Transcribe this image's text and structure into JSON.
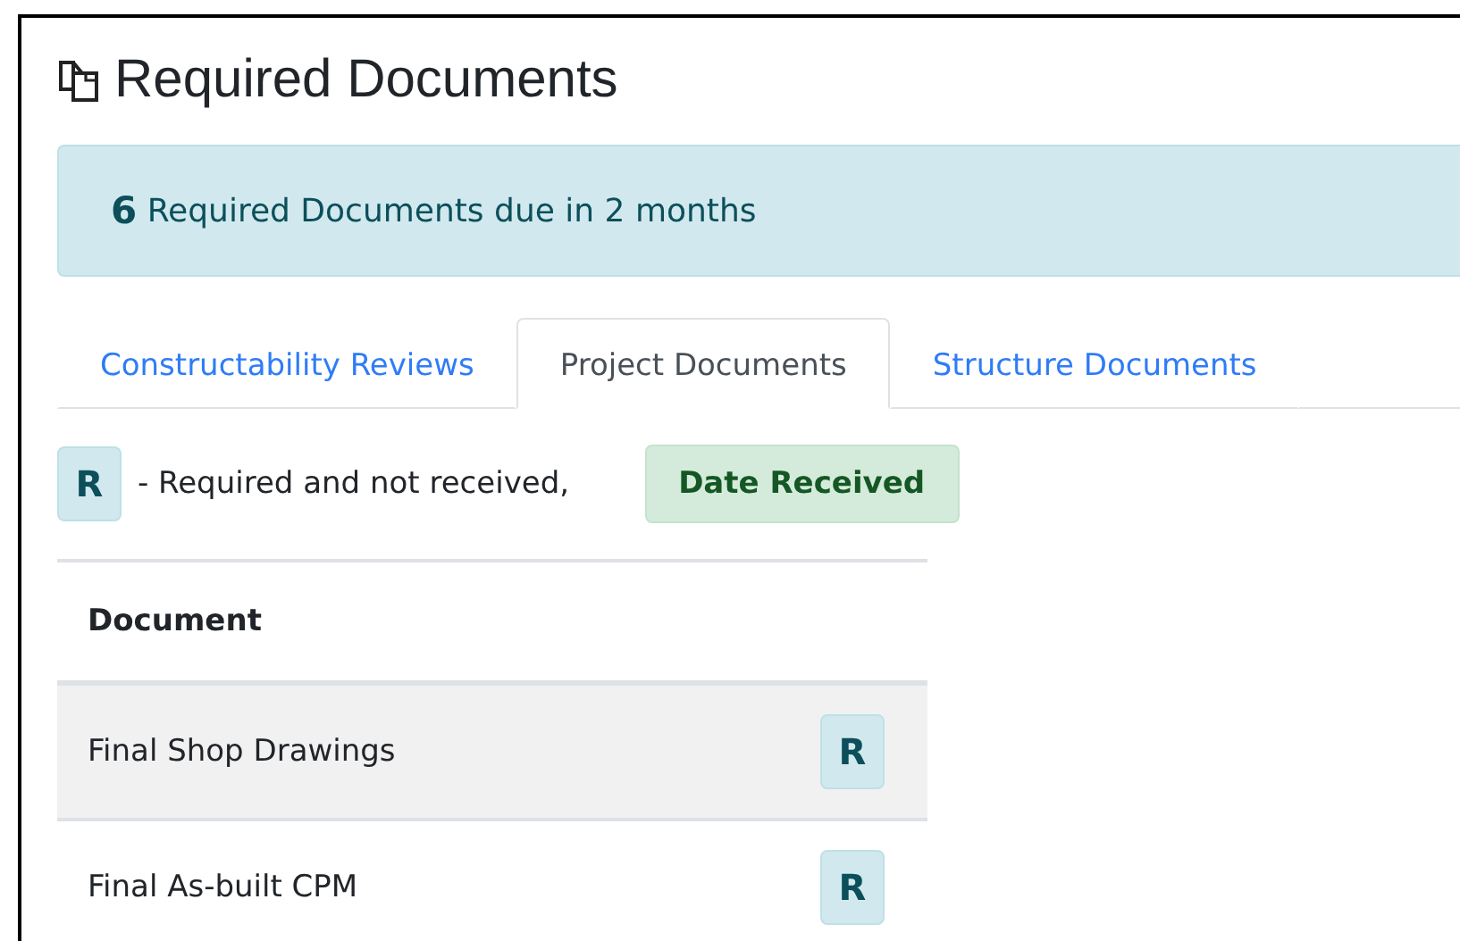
{
  "title": "Required Documents",
  "alert": {
    "count": "6",
    "text": "Required Documents due in 2 months"
  },
  "tabs": [
    {
      "label": "Constructability Reviews",
      "selected": false
    },
    {
      "label": "Project Documents",
      "selected": true
    },
    {
      "label": "Structure Documents",
      "selected": false
    }
  ],
  "legend": {
    "required_badge": "R",
    "required_text": "- Required and not received,",
    "received_badge": "Date Received"
  },
  "table": {
    "columns": [
      "Document"
    ],
    "rows": [
      {
        "document": "Final Shop Drawings",
        "status": {
          "kind": "required",
          "label": "R"
        }
      },
      {
        "document": "Final As-built CPM",
        "status": {
          "kind": "required",
          "label": "R"
        }
      }
    ]
  }
}
